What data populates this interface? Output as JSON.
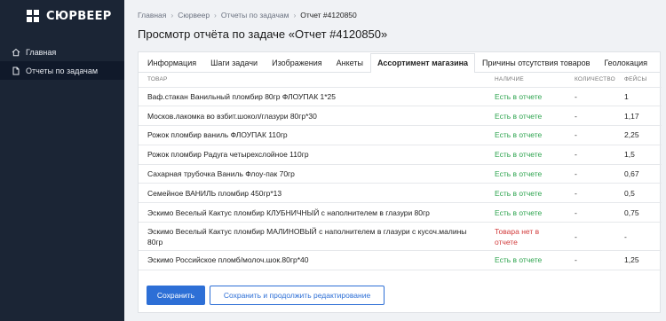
{
  "app": {
    "brand": "СЮРВЕЕР"
  },
  "sidebar": {
    "items": [
      {
        "label": "Главная",
        "icon": "home-icon"
      },
      {
        "label": "Отчеты по задачам",
        "icon": "document-icon"
      }
    ]
  },
  "breadcrumb": {
    "items": [
      "Главная",
      "Сюрвеер",
      "Отчеты по задачам"
    ],
    "current": "Отчет #4120850"
  },
  "page": {
    "title": "Просмотр отчёта по задаче «Отчет #4120850»"
  },
  "tabs": [
    "Информация",
    "Шаги задачи",
    "Изображения",
    "Анкеты",
    "Ассортимент магазина",
    "Причины отсутствия товаров",
    "Геолокация"
  ],
  "active_tab": "Ассортимент магазина",
  "table": {
    "columns": [
      "Товар",
      "Наличие",
      "Количество",
      "Фейсы"
    ],
    "rows": [
      {
        "product": "Ваф.стакан Ванильный пломбир 80гр ФЛОУПАК 1*25",
        "availability": "Есть в отчете",
        "status": "ok",
        "quantity": "-",
        "facings": "1"
      },
      {
        "product": "Москов.лакомка во взбит.шокол/глазури 80гр*30",
        "availability": "Есть в отчете",
        "status": "ok",
        "quantity": "-",
        "facings": "1,17"
      },
      {
        "product": "Рожок пломбир ваниль ФЛОУПАК 110гр",
        "availability": "Есть в отчете",
        "status": "ok",
        "quantity": "-",
        "facings": "2,25"
      },
      {
        "product": "Рожок пломбир Радуга четырехслойное 110гр",
        "availability": "Есть в отчете",
        "status": "ok",
        "quantity": "-",
        "facings": "1,5"
      },
      {
        "product": "Сахарная трубочка Ваниль Флоу-пак 70гр",
        "availability": "Есть в отчете",
        "status": "ok",
        "quantity": "-",
        "facings": "0,67"
      },
      {
        "product": "Семейное ВАНИЛЬ пломбир 450гр*13",
        "availability": "Есть в отчете",
        "status": "ok",
        "quantity": "-",
        "facings": "0,5"
      },
      {
        "product": "Эскимо Веселый Кактус пломбир КЛУБНИЧНЫЙ с наполнителем в глазури 80гр",
        "availability": "Есть в отчете",
        "status": "ok",
        "quantity": "-",
        "facings": "0,75"
      },
      {
        "product": "Эскимо Веселый Кактус пломбир МАЛИНОВЫЙ с наполнителем в глазури с кусоч.малины 80гр",
        "availability": "Товара нет в отчете",
        "status": "bad",
        "quantity": "-",
        "facings": "-"
      },
      {
        "product": "Эскимо Российское пломб/молоч.шок.80гр*40",
        "availability": "Есть в отчете",
        "status": "ok",
        "quantity": "-",
        "facings": "1,25"
      }
    ]
  },
  "actions": {
    "save": "Сохранить",
    "save_continue": "Сохранить и продолжить редактирование"
  },
  "colors": {
    "sidebar_bg": "#1b2535",
    "primary": "#2d6fd6",
    "status_ok": "#2ea44f",
    "status_bad": "#d23c3c"
  }
}
